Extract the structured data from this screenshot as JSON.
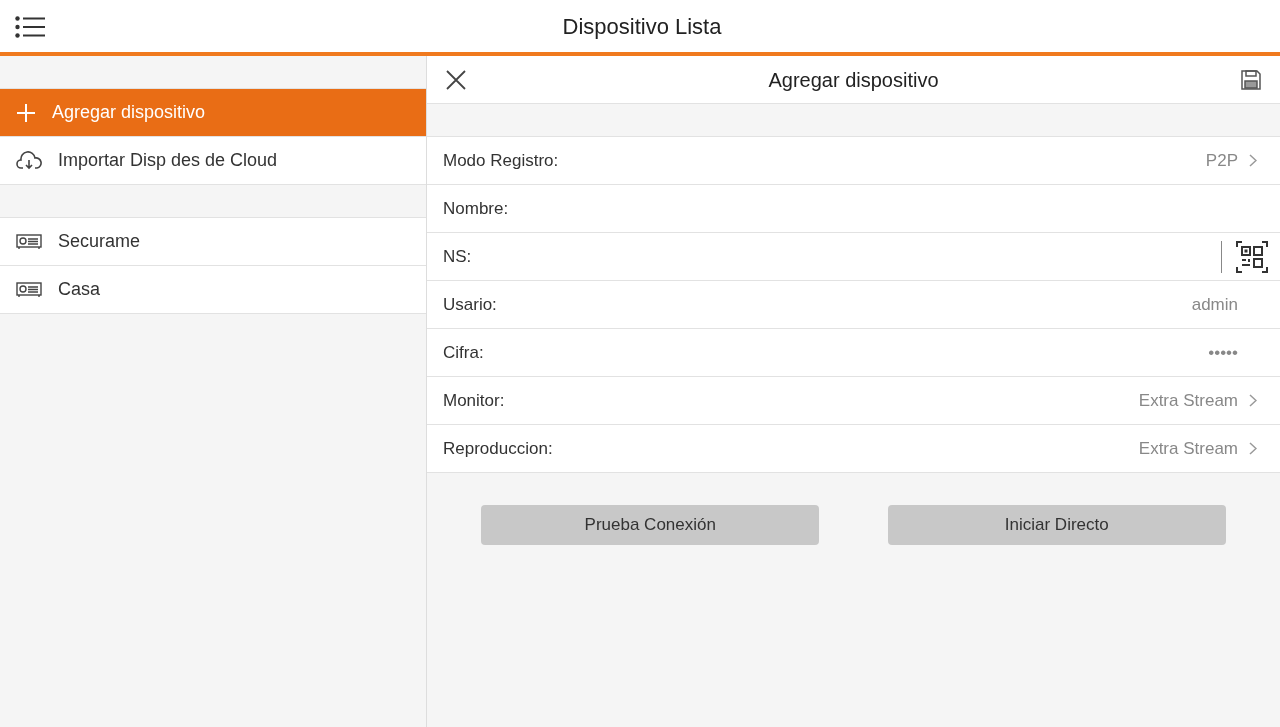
{
  "app_bar": {
    "title": "Dispositivo Lista"
  },
  "sidebar": {
    "actions": [
      {
        "kind": "add",
        "label": "Agregar dispositivo",
        "selected": true
      },
      {
        "kind": "import",
        "label": "Importar Disp des de Cloud",
        "selected": false
      }
    ],
    "devices": [
      {
        "label": "Securame",
        "selected": false
      },
      {
        "label": "Casa",
        "selected": false
      }
    ]
  },
  "panel": {
    "title": "Agregar dispositivo",
    "fields": [
      {
        "kind": "select",
        "label": "Modo Registro:",
        "value": "P2P"
      },
      {
        "kind": "text",
        "label": "Nombre:"
      },
      {
        "kind": "scan",
        "label": "NS:"
      },
      {
        "kind": "value",
        "label": "Usario:",
        "value": "admin"
      },
      {
        "kind": "value",
        "label": "Cifra:",
        "value": "•••••"
      },
      {
        "kind": "select",
        "label": "Monitor:",
        "value": "Extra Stream"
      },
      {
        "kind": "select",
        "label": "Reproduccion:",
        "value": "Extra Stream"
      }
    ],
    "buttons": [
      "Prueba Conexión",
      "Iniciar Directo"
    ]
  }
}
